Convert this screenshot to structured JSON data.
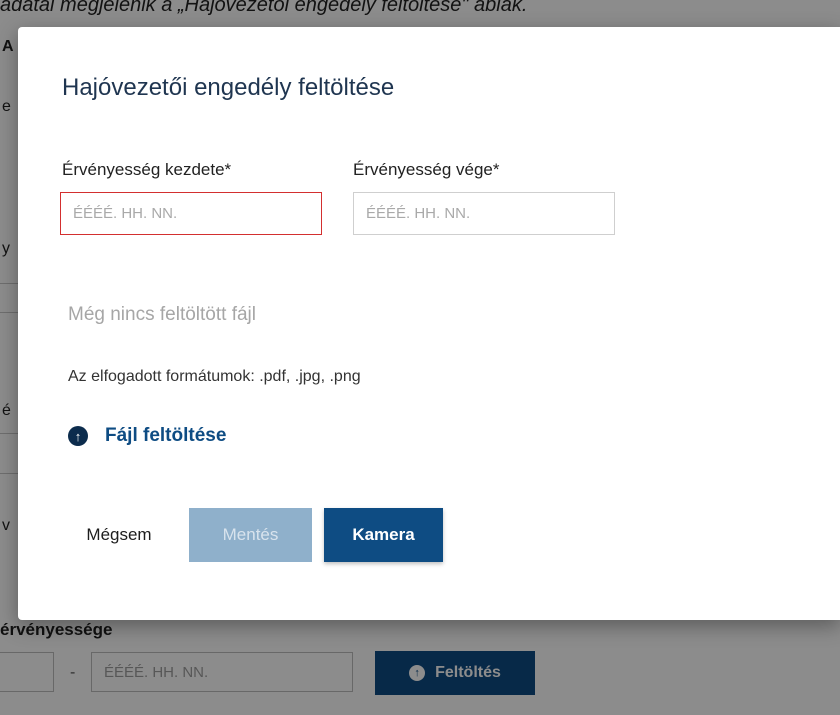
{
  "background": {
    "caption": "adatai megjelenik a „Hajóvezetői engedély feltöltése\" ablak.",
    "fragments": [
      "A",
      "e",
      "y",
      "é",
      "v"
    ],
    "section_label": "érvényessége",
    "dash": "-",
    "date_placeholder": "ÉÉÉÉ. HH. NN.",
    "upload_button": "Feltöltés"
  },
  "modal": {
    "title": "Hajóvezetői engedély feltöltése",
    "start_label": "Érvényesség kezdete*",
    "end_label": "Érvényesség vége*",
    "start_placeholder": "ÉÉÉÉ. HH. NN.",
    "end_placeholder": "ÉÉÉÉ. HH. NN.",
    "no_file_text": "Még nincs feltöltött fájl",
    "formats_text": "Az elfogadott formátumok: .pdf, .jpg, .png",
    "upload_link": "Fájl feltöltése",
    "cancel_label": "Mégsem",
    "save_label": "Mentés",
    "camera_label": "Kamera"
  },
  "icons": {
    "upload": "arrow-up-circle-icon"
  },
  "colors": {
    "primary": "#0e4c83",
    "primary_disabled": "#8fb0cb",
    "error_border": "#d32f2f",
    "title": "#1f3550"
  }
}
